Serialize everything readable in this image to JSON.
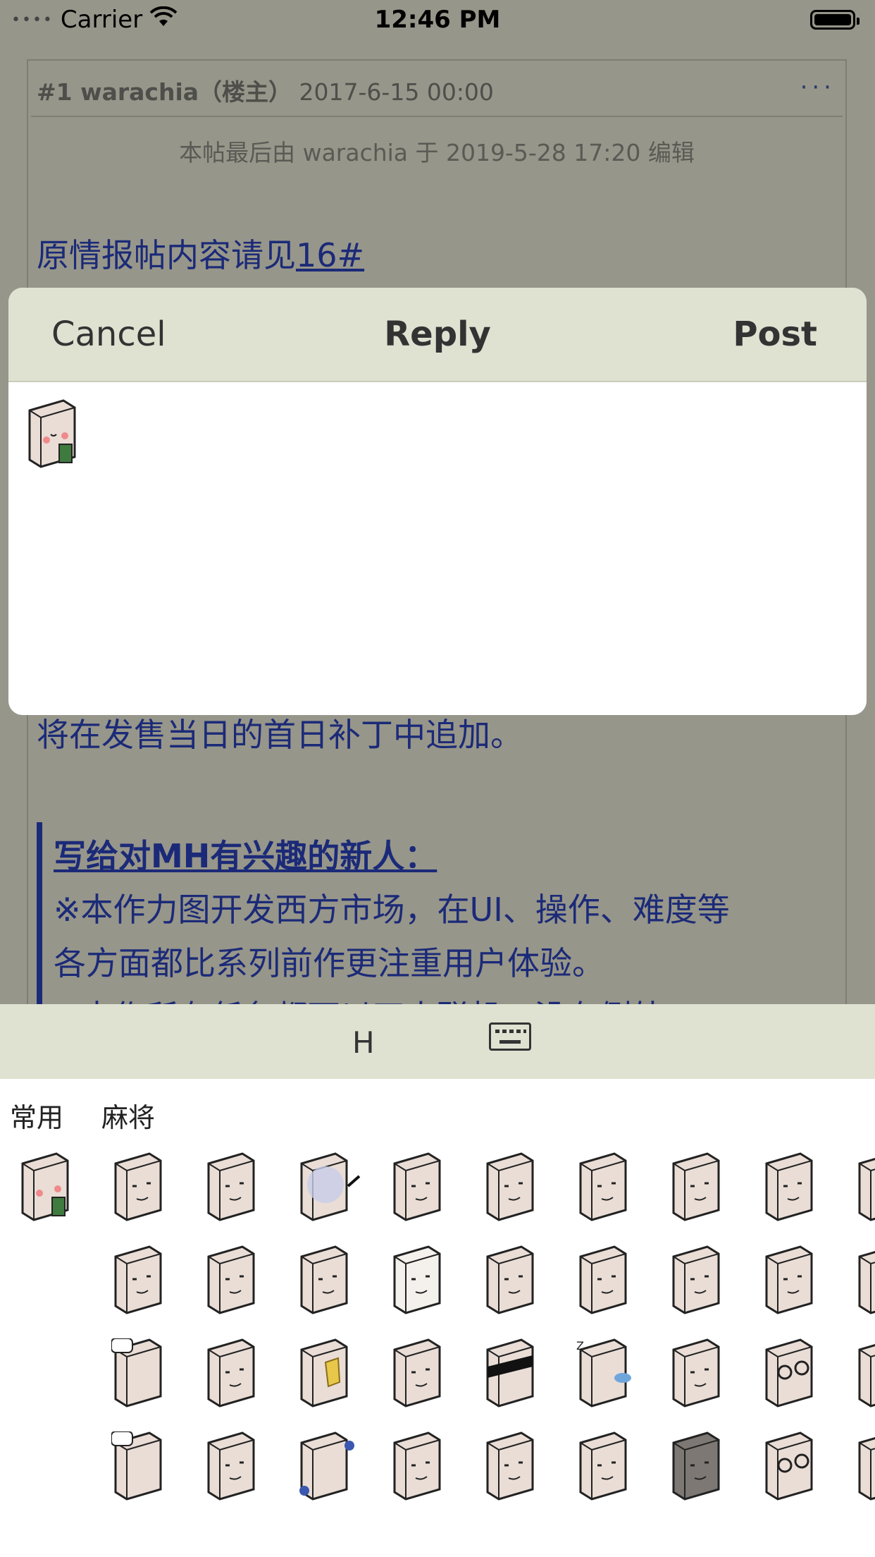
{
  "status_bar": {
    "carrier": "Carrier",
    "time": "12:46 PM",
    "signal_dots": "••••"
  },
  "post": {
    "header_num_author": "#1 warachia（楼主）",
    "header_date": "2017-6-15 00:00",
    "more": "···",
    "edit_note": "本帖最后由 warachia 于 2019-5-28 17:20 编辑",
    "link_prefix": "原情报帖内容请见",
    "link_text": "16#",
    "partial_line": "将在发售当日的首日补丁中追加。",
    "quote_heading": "写给对MH有兴趣的新人：",
    "quote_line1": " ※本作力图开发西方市场，在UI、操作、难度等",
    "quote_line2": "各方面都比系列前作更注重用户体验。",
    "quote_line3": " ※本作所有任务都可以四人联机，没有例外"
  },
  "reply_sheet": {
    "cancel_label": "Cancel",
    "title": "Reply",
    "post_label": "Post"
  },
  "emoji_panel": {
    "mode_label": "H",
    "keyboard_icon": "keyboard-icon",
    "tabs": [
      "常用",
      "麻将"
    ],
    "rows": [
      [
        "smile-tea",
        "angry",
        "blank",
        "ghost-brush",
        "sleepy",
        "tired",
        "shocked",
        "doubt",
        "smile",
        "partial"
      ],
      [
        "stern",
        "dot-eyes",
        "cross",
        "pale",
        "grin",
        "mad",
        "doubt2",
        "smug",
        "partial"
      ],
      [
        "speech",
        "wrapped",
        "yellow-card",
        "wink",
        "blindfold",
        "sleep-z",
        "cry-lines",
        "glasses",
        "partial"
      ],
      [
        "speech2",
        "shock-x",
        "headphones",
        "blank2",
        "sweat",
        "o-eyes",
        "dark",
        "glasses2",
        "partial"
      ]
    ]
  },
  "colors": {
    "link_blue": "#1b2a78",
    "bar_green": "#dfe2d1",
    "overlay": "#97968a"
  }
}
